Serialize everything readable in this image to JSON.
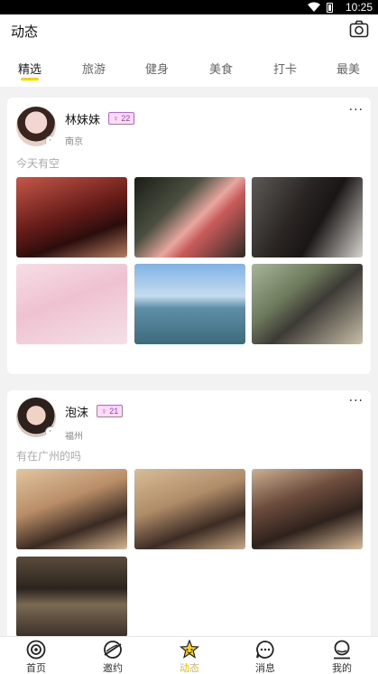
{
  "status_bar": {
    "time": "10:25"
  },
  "header": {
    "title": "动态",
    "camera_icon": "camera-icon"
  },
  "tabs": [
    {
      "label": "精选",
      "active": true
    },
    {
      "label": "旅游",
      "active": false
    },
    {
      "label": "健身",
      "active": false
    },
    {
      "label": "美食",
      "active": false
    },
    {
      "label": "打卡",
      "active": false
    },
    {
      "label": "最美",
      "active": false
    }
  ],
  "posts": [
    {
      "username": "林妹妹",
      "gender_symbol": "♀",
      "age": "22",
      "city": "南京",
      "text": "今天有空",
      "more": "···",
      "photo_count": 6
    },
    {
      "username": "泡沫",
      "gender_symbol": "♀",
      "age": "21",
      "city": "福州",
      "text": "有在广州的吗",
      "more": "···",
      "photo_count": 4
    }
  ],
  "bottom_nav": [
    {
      "label": "首页",
      "icon": "target-icon",
      "active": false
    },
    {
      "label": "邀约",
      "icon": "planet-icon",
      "active": false
    },
    {
      "label": "动态",
      "icon": "star-face-icon",
      "active": true
    },
    {
      "label": "消息",
      "icon": "chat-bubble-icon",
      "active": false
    },
    {
      "label": "我的",
      "icon": "user-icon",
      "active": false
    }
  ],
  "colors": {
    "accent": "#f7d020",
    "badge_bg": "#ffdcf5",
    "badge_border": "#b06bd8"
  }
}
